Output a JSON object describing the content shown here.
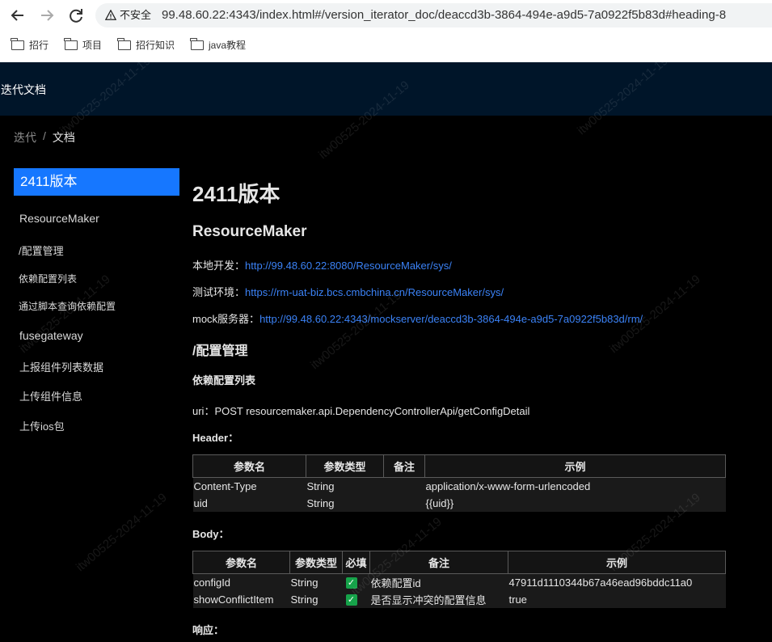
{
  "browser": {
    "security_label": "不安全",
    "url": "99.48.60.22:4343/index.html#/version_iterator_doc/deaccd3b-3864-494e-a9d5-7a0922f5b83d#heading-8",
    "bookmarks": [
      "招行",
      "项目",
      "招行知识",
      "java教程"
    ]
  },
  "header": {
    "title": "迭代文档"
  },
  "breadcrumb": {
    "items": [
      "迭代",
      "文档"
    ],
    "separator": "/"
  },
  "sidebar": {
    "items": [
      {
        "label": "2411版本",
        "active": true
      },
      {
        "label": "ResourceMaker"
      },
      {
        "label": "/配置管理"
      },
      {
        "label": "依赖配置列表"
      },
      {
        "label": "通过脚本查询依赖配置"
      },
      {
        "label": "fusegateway"
      },
      {
        "label": "上报组件列表数据"
      },
      {
        "label": "上传组件信息"
      },
      {
        "label": "上传ios包"
      }
    ]
  },
  "content": {
    "h1": "2411版本",
    "h2": "ResourceMaker",
    "env": [
      {
        "label": "本地开发：",
        "link": "http://99.48.60.22:8080/ResourceMaker/sys/"
      },
      {
        "label": "测试环境：",
        "link": "https://rm-uat-biz.bcs.cmbchina.cn/ResourceMaker/sys/"
      },
      {
        "label": "mock服务器：",
        "link": "http://99.48.60.22:4343/mockserver/deaccd3b-3864-494e-a9d5-7a0922f5b83d/rm/"
      }
    ],
    "h3": "/配置管理",
    "h4": "依赖配置列表",
    "uri": "uri：POST resourcemaker.api.DependencyControllerApi/getConfigDetail",
    "header_label": "Header：",
    "header_table": {
      "columns": [
        "参数名",
        "参数类型",
        "备注",
        "示例"
      ],
      "rows": [
        [
          "Content-Type",
          "String",
          "",
          "application/x-www-form-urlencoded"
        ],
        [
          "uid",
          "String",
          "",
          "{{uid}}"
        ]
      ]
    },
    "body_label": "Body：",
    "body_table": {
      "columns": [
        "参数名",
        "参数类型",
        "必填",
        "备注",
        "示例"
      ],
      "rows": [
        [
          "configId",
          "String",
          "✓",
          "依赖配置id",
          "47911d1110344b67a46ead96bddc11a0"
        ],
        [
          "showConflictItem",
          "String",
          "✓",
          "是否显示冲突的配置信息",
          "true"
        ]
      ]
    },
    "response_label": "响应："
  },
  "watermark": "itw00525-2024-11-19",
  "colors": {
    "header_bg": "#001529",
    "active": "#1677ff",
    "link": "#3b82f6",
    "check": "#16a34a"
  }
}
